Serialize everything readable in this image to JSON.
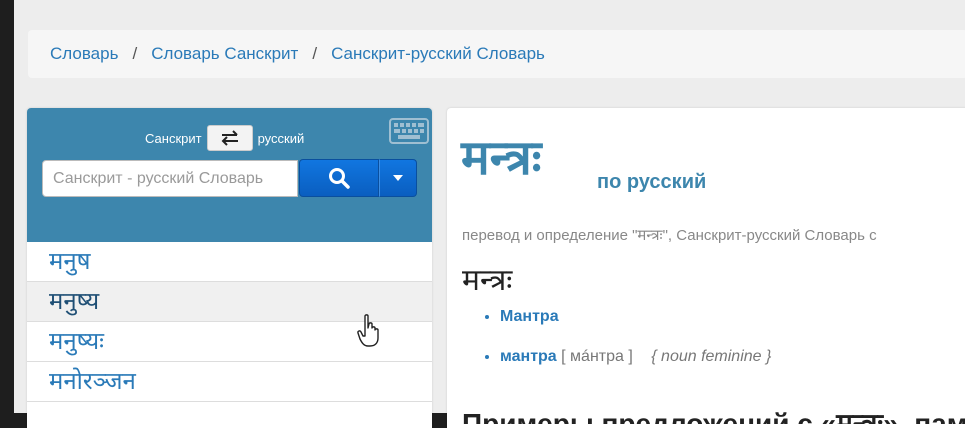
{
  "breadcrumb": {
    "items": [
      "Словарь",
      "Словарь Санскрит",
      "Санскрит-русский Словарь"
    ],
    "separator": "/"
  },
  "search": {
    "from_lang": "Санскрит",
    "to_lang": "русский",
    "swap_icon": "swap-arrows-icon",
    "placeholder": "Санскрит - русский Словарь",
    "search_icon": "search-icon",
    "dropdown_icon": "caret-down-icon",
    "keyboard_icon": "keyboard-icon"
  },
  "word_list": {
    "items": [
      "मनुष",
      "मनुष्य",
      "मनुष्यः",
      "मनोरञ्जन"
    ],
    "hovered_index": 1
  },
  "entry": {
    "headword": "मन्त्रः",
    "subtitle": "по русский",
    "description": "перевод и определение \"मन्त्रः\", Санскрит-русский Словарь  с",
    "word": "मन्त्रः",
    "translations": [
      {
        "text": "Мантра"
      },
      {
        "text": "мантра",
        "pronunciation": "[ мáнтра ]",
        "pos": "{ noun feminine }"
      }
    ],
    "next_heading": "Примеры предложений с «मन्त्रः», память переводов"
  },
  "colors": {
    "accent": "#3d86ad",
    "link": "#2a7ab8",
    "button": "#0a66cc"
  }
}
